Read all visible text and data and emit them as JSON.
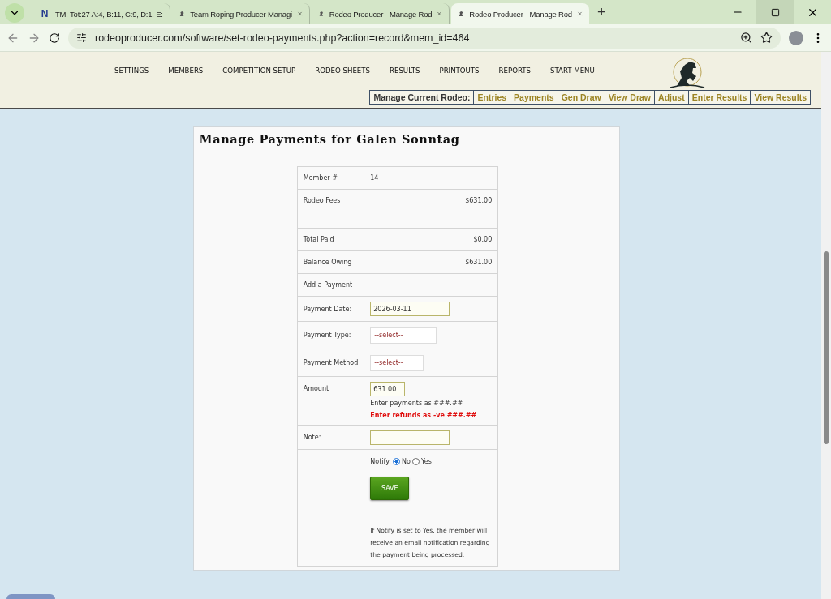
{
  "browser": {
    "tabs": [
      {
        "title": "TM: Tot:27 A:4, B:11, C:9, D:1, E:",
        "favicon_text": "N",
        "selected": false
      },
      {
        "title": "Team Roping Producer Managi",
        "selected": false
      },
      {
        "title": "Rodeo Producer - Manage Rod",
        "selected": false
      },
      {
        "title": "Rodeo Producer - Manage Rod",
        "selected": true
      }
    ],
    "new_tab": "+",
    "url": "rodeoproducer.com/software/set-rodeo-payments.php?action=record&mem_id=464"
  },
  "nav": {
    "items": [
      "SETTINGS",
      "MEMBERS",
      "COMPETITION SETUP",
      "RODEO SHEETS",
      "RESULTS",
      "PRINTOUTS",
      "REPORTS",
      "START MENU"
    ],
    "manage_label": "Manage Current Rodeo:",
    "manage_links": [
      "Entries",
      "Payments",
      "Gen Draw",
      "View Draw",
      "Adjust",
      "Enter Results",
      "View Results"
    ]
  },
  "panel": {
    "title": "Manage Payments for Galen Sonntag",
    "rows": [
      {
        "kind": "text",
        "label": "Member #",
        "value": "14"
      },
      {
        "kind": "money",
        "label": "Rodeo Fees",
        "value": "$631.00"
      },
      {
        "kind": "spacer"
      },
      {
        "kind": "money",
        "label": "Total Paid",
        "value": "$0.00"
      },
      {
        "kind": "money",
        "label": "Balance Owing",
        "value": "$631.00"
      },
      {
        "kind": "section",
        "label": "Add a Payment"
      },
      {
        "kind": "input",
        "label": "Payment Date:",
        "value": "2026-03-11"
      },
      {
        "kind": "select",
        "label": "Payment Type:",
        "value": "--select--"
      },
      {
        "kind": "select",
        "label": "Payment Method",
        "value": "--select--"
      },
      {
        "kind": "amount",
        "label": "Amount",
        "value": "631.00",
        "hint": "Enter payments as ###.##",
        "warning": "Enter refunds as -ve ###.##"
      },
      {
        "kind": "input",
        "label": "Note:"
      },
      {
        "kind": "notify",
        "label": "Notify:",
        "options": [
          {
            "label": "No",
            "selected": true
          },
          {
            "label": "Yes",
            "selected": false
          }
        ],
        "button": "SAVE",
        "info": "If Notify is set to Yes, the member will receive an email notification regarding the payment being processed."
      }
    ]
  }
}
